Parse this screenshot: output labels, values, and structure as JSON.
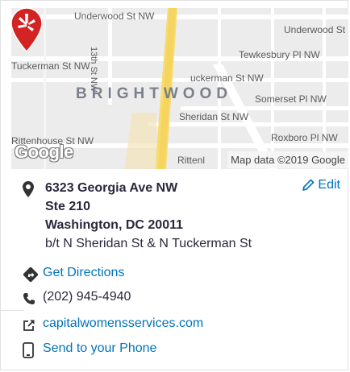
{
  "map": {
    "streets": {
      "underwood_left": "Underwood St NW",
      "underwood_right": "Underwood St NW",
      "thirteenth": "13th St NW",
      "tuckerman_left": "Tuckerman St NW",
      "tuckerman_right": "uckerman St NW",
      "tewkesbury": "Tewkesbury Pl NW",
      "somerset": "Somerset Pl NW",
      "sheridan": "Sheridan St NW",
      "roxboro": "Roxboro Pl NW",
      "rittenhouse_left": "Rittenhouse St NW",
      "rittenhouse_right": "Rittenl"
    },
    "neighborhood": "BRIGHTWOOD",
    "logo_text": "Google",
    "attribution": "Map data ©2019 Google",
    "colors": {
      "road_major": "#f7dc6f",
      "road_minor": "#ffffff",
      "background": "#ececec",
      "pin": "#d32323"
    }
  },
  "address": {
    "line1": "6323 Georgia Ave NW",
    "line2": "Ste 210",
    "line3": "Washington, DC 20011",
    "cross_streets": "b/t N Sheridan St & N Tuckerman St",
    "edit_label": "Edit"
  },
  "actions": {
    "directions_label": "Get Directions",
    "phone": "(202) 945-4940",
    "website": "capitalwomensservices.com",
    "send_phone_label": "Send to your Phone"
  },
  "icons": {
    "location": "map-pin-icon",
    "edit": "pencil-icon",
    "directions": "directions-icon",
    "phone": "phone-icon",
    "website": "external-link-icon",
    "send": "mobile-phone-icon"
  },
  "accent": "#0073bb"
}
